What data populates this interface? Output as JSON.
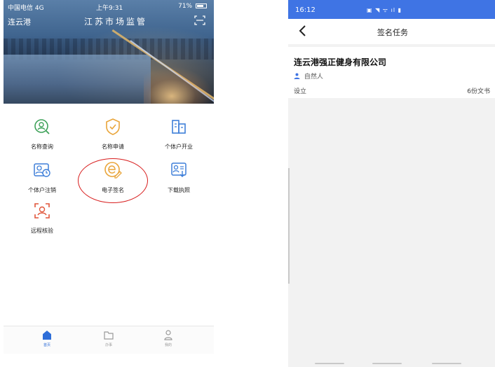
{
  "left_phone": {
    "status": {
      "carrier": "中国电信  4G",
      "time": "上午9:31",
      "battery": "71%"
    },
    "header": {
      "city": "连云港",
      "title": "江苏市场监管"
    },
    "menu": [
      {
        "label": "名称查询",
        "icon": "face-search-icon"
      },
      {
        "label": "名称申请",
        "icon": "shield-check-icon"
      },
      {
        "label": "个体户开业",
        "icon": "building-icon"
      },
      {
        "label": "个体户注销",
        "icon": "person-clock-icon"
      },
      {
        "label": "电子签名",
        "icon": "e-sign-icon"
      },
      {
        "label": "下载执照",
        "icon": "license-download-icon"
      },
      {
        "label": "远程核验",
        "icon": "face-frame-icon"
      }
    ],
    "tabs": [
      {
        "label": "首页",
        "icon": "home-icon",
        "active": true
      },
      {
        "label": "办事",
        "icon": "folder-icon",
        "active": false
      },
      {
        "label": "我的",
        "icon": "user-icon",
        "active": false
      }
    ],
    "colors": {
      "accent": "#2e6ed8",
      "annotation": "#d81e1e"
    }
  },
  "right_phone": {
    "status": {
      "time": "16:12",
      "icons": "▣ ◥ ᯤ ıl ▮"
    },
    "nav": {
      "title": "签名任务"
    },
    "task": {
      "company": "连云港强正健身有限公司",
      "person": "自然人",
      "type": "设立",
      "docs": "6份文书"
    },
    "colors": {
      "status_bar": "#3f74e4"
    }
  }
}
